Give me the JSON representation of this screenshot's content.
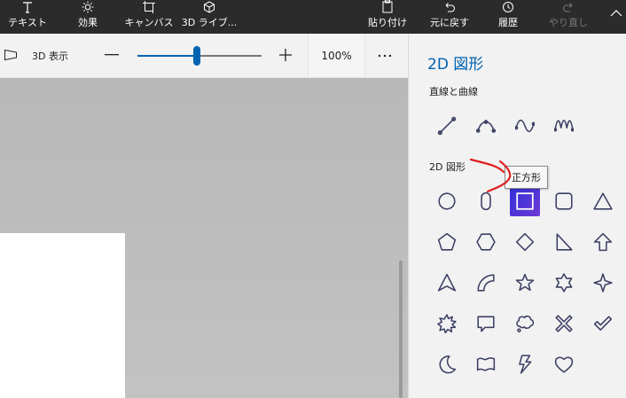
{
  "topbar": {
    "buttons": [
      {
        "name": "text-button",
        "icon": "text-icon",
        "label": "テキスト"
      },
      {
        "name": "effects-button",
        "icon": "sun-icon",
        "label": "効果"
      },
      {
        "name": "canvas-button",
        "icon": "canvas-icon",
        "label": "キャンバス"
      },
      {
        "name": "3d-library-button",
        "icon": "cube-icon",
        "label": "3D ライブ..."
      },
      {
        "name": "paste-button",
        "icon": "clipboard-icon",
        "label": "貼り付け"
      },
      {
        "name": "undo-button",
        "icon": "undo-icon",
        "label": "元に戻す"
      },
      {
        "name": "history-button",
        "icon": "history-icon",
        "label": "履歴"
      },
      {
        "name": "redo-button",
        "icon": "redo-icon",
        "label": "やり直し"
      }
    ]
  },
  "subbar": {
    "view_label": "3D 表示",
    "zoom_minus": "—",
    "zoom_plus": "+",
    "zoom_percent": "100%",
    "zoom_level": 0.48,
    "more": "···"
  },
  "panel": {
    "title": "2D 図形",
    "lines_section": "直線と曲線",
    "shapes_section": "2D 図形",
    "tooltip": "正方形",
    "line_tools": [
      "line-icon",
      "curve-icon",
      "wave-curve-icon",
      "zigzag-curve-icon"
    ],
    "shape_tools": [
      "circle-icon",
      "pill-icon",
      "square-icon",
      "rounded-square-icon",
      "triangle-icon",
      "pentagon-icon",
      "hexagon-icon",
      "diamond-icon",
      "right-triangle-icon",
      "arrow-up-icon",
      "arrowhead-icon",
      "quarter-arc-icon",
      "star5-icon",
      "star6-icon",
      "star4-icon",
      "burst-icon",
      "speech-bubble-icon",
      "thought-bubble-icon",
      "x-mark-icon",
      "checkmark-icon",
      "crescent-icon",
      "banner-icon",
      "lightning-icon",
      "heart-icon"
    ],
    "selected_shape": "square-icon"
  },
  "colors": {
    "accent": "#0063b1",
    "topbar": "#2b2b2b",
    "panel": "#f2f2f2",
    "annotation": "#e02020"
  }
}
